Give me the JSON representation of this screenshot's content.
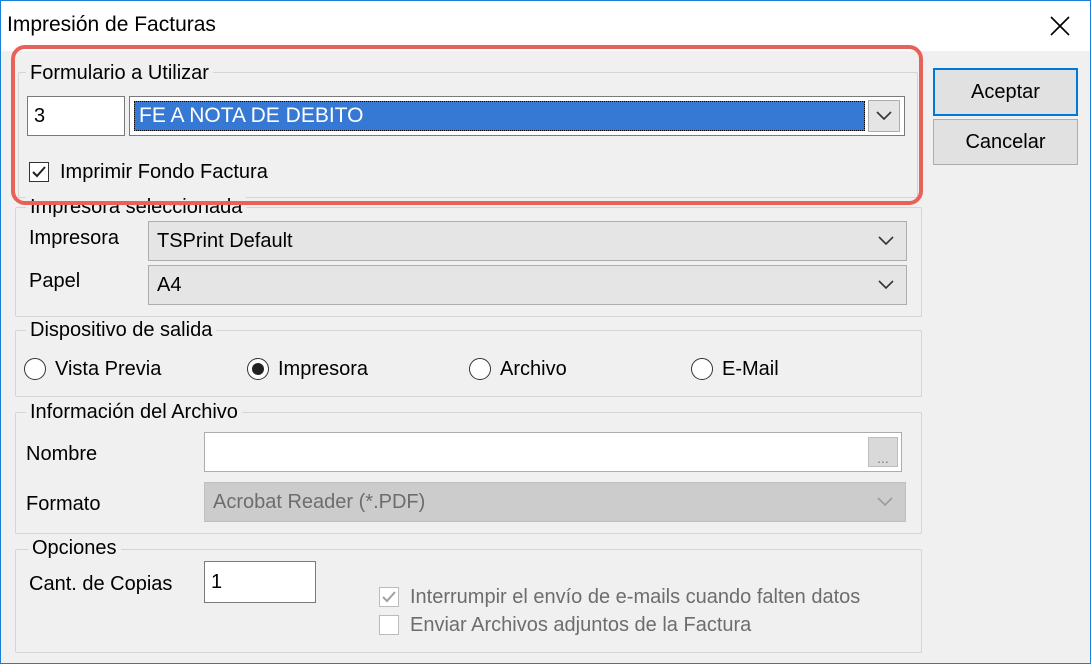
{
  "window": {
    "title": "Impresión de Facturas",
    "close_icon": "close-icon"
  },
  "formulario": {
    "legend": "Formulario a Utilizar",
    "code_value": "3",
    "selected_form": "FE A NOTA DE DEBITO",
    "print_background_label": "Imprimir Fondo Factura",
    "print_background_checked": true
  },
  "buttons": {
    "accept_label": "Aceptar",
    "cancel_label": "Cancelar"
  },
  "impresora_group": {
    "legend": "Impresora seleccionada",
    "printer_label": "Impresora",
    "printer_value": "TSPrint Default",
    "paper_label": "Papel",
    "paper_value": "A4"
  },
  "output": {
    "legend": "Dispositivo de salida",
    "options": [
      "Vista Previa",
      "Impresora",
      "Archivo",
      "E-Mail"
    ],
    "selected": "Impresora"
  },
  "file_info": {
    "legend": "Información del Archivo",
    "name_label": "Nombre",
    "name_value": "",
    "browse_label": "...",
    "format_label": "Formato",
    "format_value": "Acrobat Reader (*.PDF)"
  },
  "options": {
    "legend": "Opciones",
    "copies_label": "Cant. de Copias",
    "copies_value": "1",
    "interrupt_label": "Interrumpir el envío de e-mails cuando falten datos",
    "interrupt_checked": true,
    "attach_label": "Enviar Archivos adjuntos de la Factura",
    "attach_checked": false
  },
  "colors": {
    "accent": "#0078d7",
    "selection": "#3579d4",
    "highlight": "#e8625a"
  }
}
